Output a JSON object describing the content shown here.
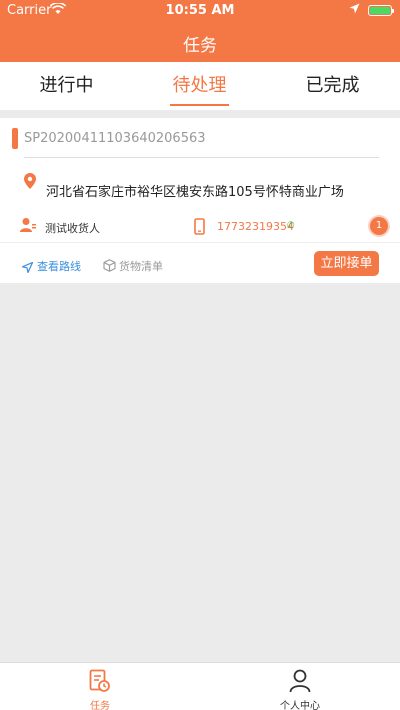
{
  "status_bar": {
    "carrier": "Carrier",
    "time": "10:55 AM",
    "battery_percent": 100
  },
  "nav": {
    "title": "任务"
  },
  "tabs": [
    {
      "label": "进行中",
      "active": false
    },
    {
      "label": "待处理",
      "active": true
    },
    {
      "label": "已完成",
      "active": false
    }
  ],
  "order": {
    "order_no": "SP20200411103640206563",
    "address": "河北省石家庄市裕华区槐安东路105号怀特商业广场",
    "receiver": "测试收货人",
    "phone": "17732319354",
    "badge": "1",
    "route_label": "查看路线",
    "goods_label": "货物清单",
    "accept_label": "立即接单"
  },
  "bottom_tabs": [
    {
      "label": "任务",
      "icon": "task-icon",
      "active": true
    },
    {
      "label": "个人中心",
      "icon": "person-icon",
      "active": false
    }
  ],
  "colors": {
    "accent": "#f47846",
    "link": "#3a8fe0",
    "call": "#4cb050"
  }
}
